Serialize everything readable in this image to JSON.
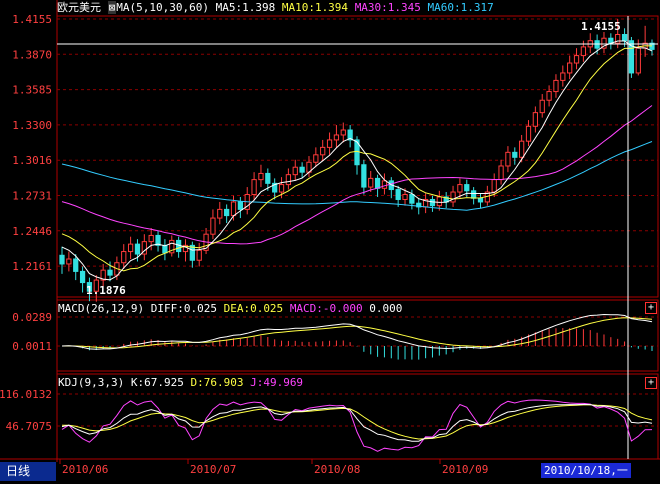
{
  "window": {
    "mode_label": "日线"
  },
  "main_panel": {
    "instrument": "欧元美元",
    "indicator": "MA(5,10,30,60)",
    "ma5": "MA5:1.398",
    "ma10": "MA10:1.394",
    "ma30": "MA30:1.345",
    "ma60": "MA60:1.317",
    "y_ticks": [
      "1.4155",
      "1.3870",
      "1.3585",
      "1.3300",
      "1.3016",
      "1.2731",
      "1.2446",
      "1.2161"
    ],
    "high_label": "1.4155",
    "low_label": "1.1876"
  },
  "macd_panel": {
    "indicator": "MACD(26,12,9)",
    "diff": "DIFF:0.025",
    "dea": "DEA:0.025",
    "macd": "MACD:-0.000",
    "extra": "0.000",
    "y_ticks": [
      "0.0289",
      "0.0011"
    ]
  },
  "kdj_panel": {
    "indicator": "KDJ(9,3,3)",
    "k": "K:67.925",
    "d": "D:76.903",
    "j": "J:49.969",
    "y_ticks": [
      "116.0132",
      "46.7075"
    ]
  },
  "x_axis": {
    "ticks": [
      "2010/06",
      "2010/07",
      "2010/08",
      "2010/09"
    ],
    "cursor_date": "2010/10/18,一"
  },
  "colors": {
    "up": "#ff3b3b",
    "down": "#33e0e0",
    "ma5": "#ffffff",
    "ma10": "#ffff44",
    "ma30": "#ff44ff",
    "ma60": "#33ccff",
    "grid": "#8b0000",
    "axis_text": "#ff4040"
  },
  "chart_data": {
    "type": "candlestick",
    "price_ylim": [
      1.19,
      1.4155
    ],
    "candles": [
      {
        "o": 1.225,
        "c": 1.218,
        "h": 1.232,
        "l": 1.21
      },
      {
        "o": 1.218,
        "c": 1.222,
        "h": 1.228,
        "l": 1.212
      },
      {
        "o": 1.222,
        "c": 1.212,
        "h": 1.226,
        "l": 1.205
      },
      {
        "o": 1.212,
        "c": 1.203,
        "h": 1.216,
        "l": 1.195
      },
      {
        "o": 1.203,
        "c": 1.196,
        "h": 1.207,
        "l": 1.188
      },
      {
        "o": 1.196,
        "c": 1.205,
        "h": 1.209,
        "l": 1.1876
      },
      {
        "o": 1.205,
        "c": 1.213,
        "h": 1.218,
        "l": 1.2
      },
      {
        "o": 1.213,
        "c": 1.209,
        "h": 1.22,
        "l": 1.204
      },
      {
        "o": 1.209,
        "c": 1.219,
        "h": 1.224,
        "l": 1.205
      },
      {
        "o": 1.219,
        "c": 1.228,
        "h": 1.234,
        "l": 1.214
      },
      {
        "o": 1.228,
        "c": 1.234,
        "h": 1.24,
        "l": 1.222
      },
      {
        "o": 1.234,
        "c": 1.226,
        "h": 1.238,
        "l": 1.22
      },
      {
        "o": 1.226,
        "c": 1.236,
        "h": 1.242,
        "l": 1.221
      },
      {
        "o": 1.236,
        "c": 1.241,
        "h": 1.247,
        "l": 1.229
      },
      {
        "o": 1.241,
        "c": 1.233,
        "h": 1.245,
        "l": 1.228
      },
      {
        "o": 1.233,
        "c": 1.227,
        "h": 1.238,
        "l": 1.221
      },
      {
        "o": 1.227,
        "c": 1.237,
        "h": 1.241,
        "l": 1.224
      },
      {
        "o": 1.237,
        "c": 1.228,
        "h": 1.24,
        "l": 1.223
      },
      {
        "o": 1.228,
        "c": 1.233,
        "h": 1.238,
        "l": 1.22
      },
      {
        "o": 1.233,
        "c": 1.221,
        "h": 1.236,
        "l": 1.215
      },
      {
        "o": 1.221,
        "c": 1.229,
        "h": 1.235,
        "l": 1.216
      },
      {
        "o": 1.229,
        "c": 1.242,
        "h": 1.247,
        "l": 1.226
      },
      {
        "o": 1.242,
        "c": 1.255,
        "h": 1.262,
        "l": 1.238
      },
      {
        "o": 1.255,
        "c": 1.262,
        "h": 1.268,
        "l": 1.25
      },
      {
        "o": 1.262,
        "c": 1.257,
        "h": 1.266,
        "l": 1.251
      },
      {
        "o": 1.257,
        "c": 1.268,
        "h": 1.273,
        "l": 1.253
      },
      {
        "o": 1.268,
        "c": 1.262,
        "h": 1.272,
        "l": 1.255
      },
      {
        "o": 1.262,
        "c": 1.274,
        "h": 1.28,
        "l": 1.258
      },
      {
        "o": 1.274,
        "c": 1.286,
        "h": 1.292,
        "l": 1.269
      },
      {
        "o": 1.286,
        "c": 1.291,
        "h": 1.298,
        "l": 1.28
      },
      {
        "o": 1.291,
        "c": 1.283,
        "h": 1.295,
        "l": 1.277
      },
      {
        "o": 1.283,
        "c": 1.276,
        "h": 1.287,
        "l": 1.27
      },
      {
        "o": 1.276,
        "c": 1.282,
        "h": 1.288,
        "l": 1.271
      },
      {
        "o": 1.282,
        "c": 1.29,
        "h": 1.295,
        "l": 1.278
      },
      {
        "o": 1.29,
        "c": 1.296,
        "h": 1.302,
        "l": 1.285
      },
      {
        "o": 1.296,
        "c": 1.292,
        "h": 1.3,
        "l": 1.287
      },
      {
        "o": 1.292,
        "c": 1.3,
        "h": 1.305,
        "l": 1.288
      },
      {
        "o": 1.3,
        "c": 1.306,
        "h": 1.312,
        "l": 1.296
      },
      {
        "o": 1.306,
        "c": 1.312,
        "h": 1.318,
        "l": 1.301
      },
      {
        "o": 1.312,
        "c": 1.318,
        "h": 1.324,
        "l": 1.306
      },
      {
        "o": 1.318,
        "c": 1.322,
        "h": 1.33,
        "l": 1.312
      },
      {
        "o": 1.322,
        "c": 1.326,
        "h": 1.332,
        "l": 1.316
      },
      {
        "o": 1.326,
        "c": 1.318,
        "h": 1.33,
        "l": 1.312
      },
      {
        "o": 1.318,
        "c": 1.298,
        "h": 1.321,
        "l": 1.29
      },
      {
        "o": 1.298,
        "c": 1.28,
        "h": 1.302,
        "l": 1.274
      },
      {
        "o": 1.28,
        "c": 1.287,
        "h": 1.293,
        "l": 1.276
      },
      {
        "o": 1.287,
        "c": 1.279,
        "h": 1.29,
        "l": 1.272
      },
      {
        "o": 1.279,
        "c": 1.285,
        "h": 1.291,
        "l": 1.274
      },
      {
        "o": 1.285,
        "c": 1.278,
        "h": 1.288,
        "l": 1.271
      },
      {
        "o": 1.278,
        "c": 1.27,
        "h": 1.281,
        "l": 1.264
      },
      {
        "o": 1.27,
        "c": 1.274,
        "h": 1.279,
        "l": 1.265
      },
      {
        "o": 1.274,
        "c": 1.267,
        "h": 1.278,
        "l": 1.262
      },
      {
        "o": 1.267,
        "c": 1.264,
        "h": 1.271,
        "l": 1.258
      },
      {
        "o": 1.264,
        "c": 1.27,
        "h": 1.275,
        "l": 1.259
      },
      {
        "o": 1.27,
        "c": 1.265,
        "h": 1.273,
        "l": 1.26
      },
      {
        "o": 1.265,
        "c": 1.272,
        "h": 1.277,
        "l": 1.261
      },
      {
        "o": 1.272,
        "c": 1.268,
        "h": 1.276,
        "l": 1.263
      },
      {
        "o": 1.268,
        "c": 1.276,
        "h": 1.281,
        "l": 1.264
      },
      {
        "o": 1.276,
        "c": 1.282,
        "h": 1.287,
        "l": 1.271
      },
      {
        "o": 1.282,
        "c": 1.277,
        "h": 1.286,
        "l": 1.272
      },
      {
        "o": 1.277,
        "c": 1.271,
        "h": 1.28,
        "l": 1.266
      },
      {
        "o": 1.271,
        "c": 1.268,
        "h": 1.275,
        "l": 1.263
      },
      {
        "o": 1.268,
        "c": 1.276,
        "h": 1.281,
        "l": 1.265
      },
      {
        "o": 1.276,
        "c": 1.286,
        "h": 1.291,
        "l": 1.272
      },
      {
        "o": 1.286,
        "c": 1.297,
        "h": 1.302,
        "l": 1.282
      },
      {
        "o": 1.297,
        "c": 1.308,
        "h": 1.313,
        "l": 1.292
      },
      {
        "o": 1.308,
        "c": 1.304,
        "h": 1.312,
        "l": 1.298
      },
      {
        "o": 1.304,
        "c": 1.317,
        "h": 1.322,
        "l": 1.3
      },
      {
        "o": 1.317,
        "c": 1.329,
        "h": 1.334,
        "l": 1.313
      },
      {
        "o": 1.329,
        "c": 1.34,
        "h": 1.345,
        "l": 1.324
      },
      {
        "o": 1.34,
        "c": 1.35,
        "h": 1.355,
        "l": 1.336
      },
      {
        "o": 1.35,
        "c": 1.357,
        "h": 1.362,
        "l": 1.345
      },
      {
        "o": 1.357,
        "c": 1.366,
        "h": 1.371,
        "l": 1.352
      },
      {
        "o": 1.366,
        "c": 1.372,
        "h": 1.378,
        "l": 1.361
      },
      {
        "o": 1.372,
        "c": 1.38,
        "h": 1.386,
        "l": 1.367
      },
      {
        "o": 1.38,
        "c": 1.386,
        "h": 1.392,
        "l": 1.375
      },
      {
        "o": 1.386,
        "c": 1.393,
        "h": 1.398,
        "l": 1.381
      },
      {
        "o": 1.393,
        "c": 1.398,
        "h": 1.404,
        "l": 1.388
      },
      {
        "o": 1.398,
        "c": 1.392,
        "h": 1.403,
        "l": 1.387
      },
      {
        "o": 1.392,
        "c": 1.4,
        "h": 1.405,
        "l": 1.388
      },
      {
        "o": 1.4,
        "c": 1.396,
        "h": 1.404,
        "l": 1.391
      },
      {
        "o": 1.396,
        "c": 1.403,
        "h": 1.4155,
        "l": 1.392
      },
      {
        "o": 1.403,
        "c": 1.398,
        "h": 1.408,
        "l": 1.393
      },
      {
        "o": 1.398,
        "c": 1.372,
        "h": 1.401,
        "l": 1.368
      },
      {
        "o": 1.372,
        "c": 1.392,
        "h": 1.399,
        "l": 1.37
      },
      {
        "o": 1.392,
        "c": 1.396,
        "h": 1.41,
        "l": 1.385
      },
      {
        "o": 1.396,
        "c": 1.391,
        "h": 1.399,
        "l": 1.386
      }
    ]
  }
}
